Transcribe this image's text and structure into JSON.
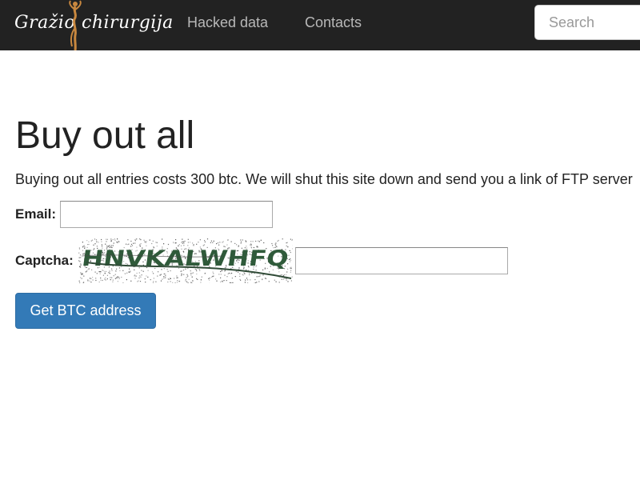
{
  "navbar": {
    "brand_word1": "Gražio",
    "brand_word2": "chirurgija",
    "links": [
      {
        "label": "Hacked data"
      },
      {
        "label": "Contacts"
      }
    ],
    "search_placeholder": "Search"
  },
  "main": {
    "title": "Buy out all",
    "description": "Buying out all entries costs 300 btc. We will shut this site down and send you a link of FTP server",
    "email_label": "Email:",
    "captcha_label": "Captcha:",
    "captcha_text": "HNVKALWHFQ",
    "submit_label": "Get BTC address"
  },
  "colors": {
    "navbar_bg": "#222222",
    "nav_link": "#b8b8b8",
    "primary_button": "#337ab7",
    "captcha_ink": "#2f5a3a"
  },
  "icons": {
    "brand_figure": "dancer-figure-icon"
  }
}
